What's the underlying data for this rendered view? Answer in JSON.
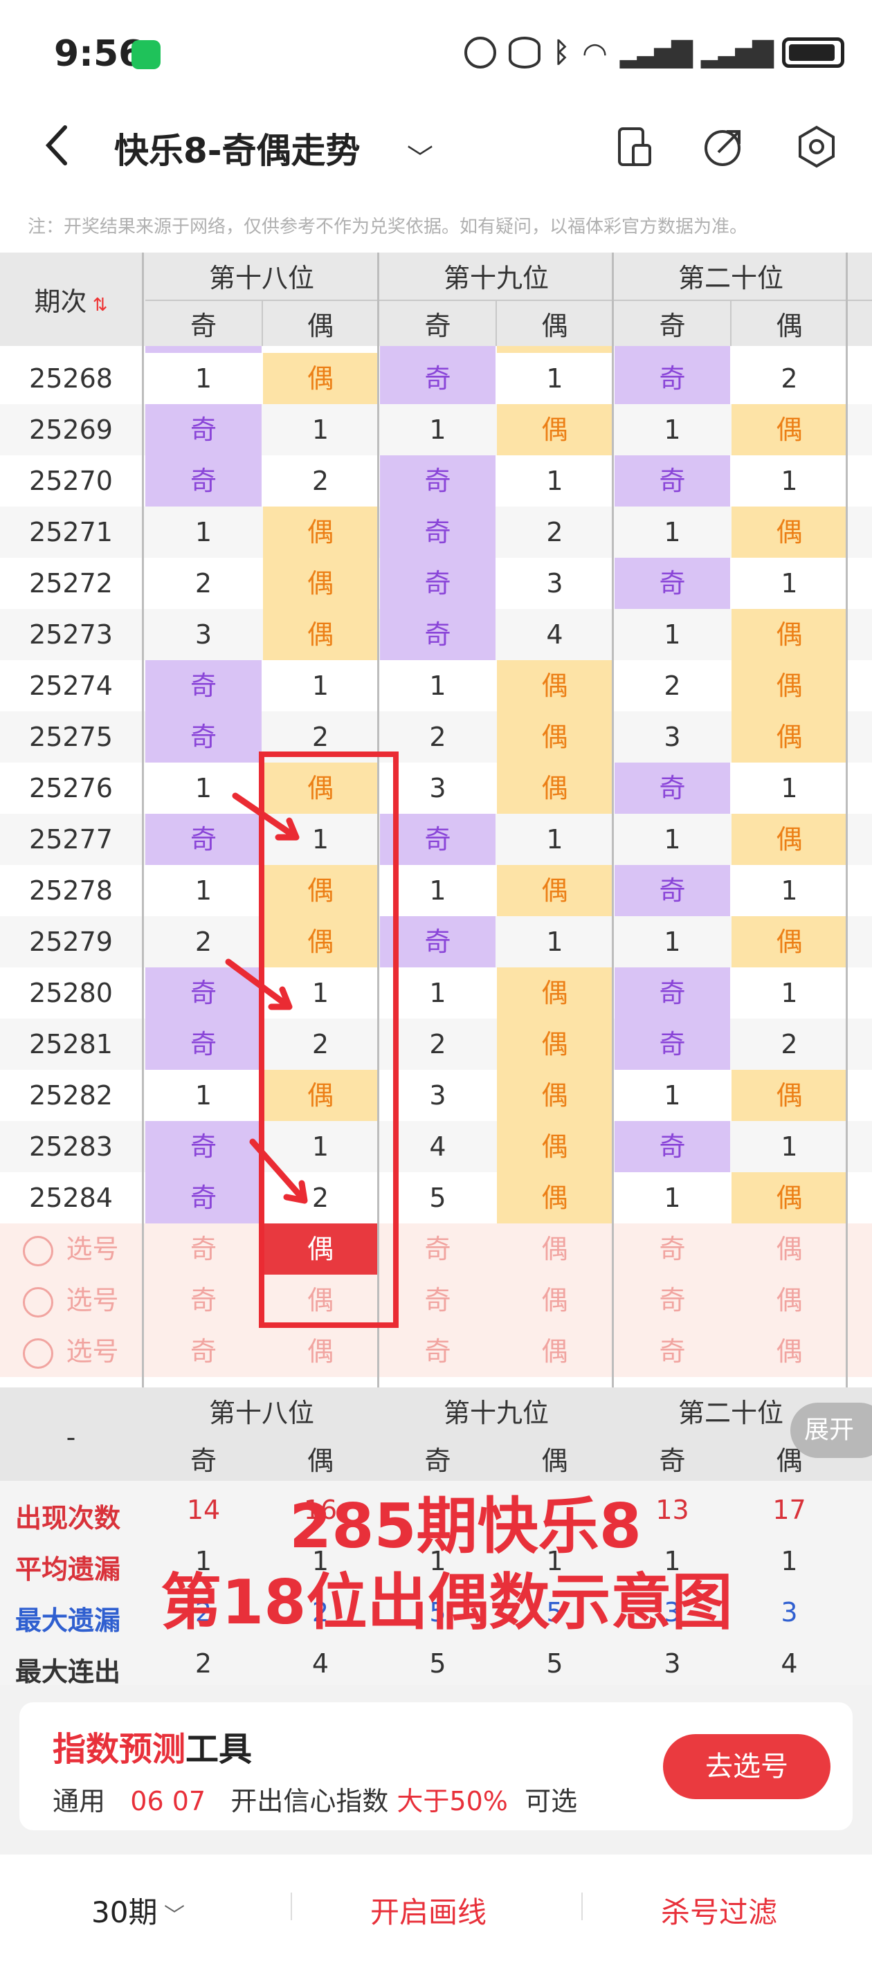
{
  "status": {
    "time": "9:56"
  },
  "header": {
    "title": "快乐8-奇偶走势"
  },
  "notice": "注：开奖结果来源于网络，仅供参考不作为兑奖依据。如有疑问，以福体彩官方数据为准。",
  "table": {
    "col_period": "期次",
    "groups": [
      "第十八位",
      "第十九位",
      "第二十位"
    ],
    "sub": [
      "奇",
      "偶",
      "奇",
      "偶",
      "奇",
      "偶"
    ],
    "rows": [
      {
        "p": "25268",
        "c": [
          "1",
          "偶",
          "奇",
          "1",
          "奇",
          "2"
        ],
        "t": [
          0,
          1,
          2,
          0,
          2,
          0
        ]
      },
      {
        "p": "25269",
        "c": [
          "奇",
          "1",
          "1",
          "偶",
          "1",
          "偶"
        ],
        "t": [
          2,
          0,
          0,
          1,
          0,
          1
        ]
      },
      {
        "p": "25270",
        "c": [
          "奇",
          "2",
          "奇",
          "1",
          "奇",
          "1"
        ],
        "t": [
          2,
          0,
          2,
          0,
          2,
          0
        ]
      },
      {
        "p": "25271",
        "c": [
          "1",
          "偶",
          "奇",
          "2",
          "1",
          "偶"
        ],
        "t": [
          0,
          1,
          2,
          0,
          0,
          1
        ]
      },
      {
        "p": "25272",
        "c": [
          "2",
          "偶",
          "奇",
          "3",
          "奇",
          "1"
        ],
        "t": [
          0,
          1,
          2,
          0,
          2,
          0
        ]
      },
      {
        "p": "25273",
        "c": [
          "3",
          "偶",
          "奇",
          "4",
          "1",
          "偶"
        ],
        "t": [
          0,
          1,
          2,
          0,
          0,
          1
        ]
      },
      {
        "p": "25274",
        "c": [
          "奇",
          "1",
          "1",
          "偶",
          "2",
          "偶"
        ],
        "t": [
          2,
          0,
          0,
          1,
          0,
          1
        ]
      },
      {
        "p": "25275",
        "c": [
          "奇",
          "2",
          "2",
          "偶",
          "3",
          "偶"
        ],
        "t": [
          2,
          0,
          0,
          1,
          0,
          1
        ]
      },
      {
        "p": "25276",
        "c": [
          "1",
          "偶",
          "3",
          "偶",
          "奇",
          "1"
        ],
        "t": [
          0,
          1,
          0,
          1,
          2,
          0
        ]
      },
      {
        "p": "25277",
        "c": [
          "奇",
          "1",
          "奇",
          "1",
          "1",
          "偶"
        ],
        "t": [
          2,
          0,
          2,
          0,
          0,
          1
        ]
      },
      {
        "p": "25278",
        "c": [
          "1",
          "偶",
          "1",
          "偶",
          "奇",
          "1"
        ],
        "t": [
          0,
          1,
          0,
          1,
          2,
          0
        ]
      },
      {
        "p": "25279",
        "c": [
          "2",
          "偶",
          "奇",
          "1",
          "1",
          "偶"
        ],
        "t": [
          0,
          1,
          2,
          0,
          0,
          1
        ]
      },
      {
        "p": "25280",
        "c": [
          "奇",
          "1",
          "1",
          "偶",
          "奇",
          "1"
        ],
        "t": [
          2,
          0,
          0,
          1,
          2,
          0
        ]
      },
      {
        "p": "25281",
        "c": [
          "奇",
          "2",
          "2",
          "偶",
          "奇",
          "2"
        ],
        "t": [
          2,
          0,
          0,
          1,
          2,
          0
        ]
      },
      {
        "p": "25282",
        "c": [
          "1",
          "偶",
          "3",
          "偶",
          "1",
          "偶"
        ],
        "t": [
          0,
          1,
          0,
          1,
          0,
          1
        ]
      },
      {
        "p": "25283",
        "c": [
          "奇",
          "1",
          "4",
          "偶",
          "奇",
          "1"
        ],
        "t": [
          2,
          0,
          0,
          1,
          2,
          0
        ]
      },
      {
        "p": "25284",
        "c": [
          "奇",
          "2",
          "5",
          "偶",
          "1",
          "偶"
        ],
        "t": [
          2,
          0,
          0,
          1,
          0,
          1
        ]
      }
    ],
    "pick_label": "选号",
    "pick_cells": [
      "奇",
      "偶",
      "奇",
      "偶",
      "奇",
      "偶"
    ],
    "selected_cell": "偶"
  },
  "stats": {
    "dash": "-",
    "expand": "展开",
    "rows": [
      {
        "label": "出现次数",
        "color": "#d9323a",
        "v": [
          "14",
          "16",
          "",
          "",
          "13",
          "17"
        ]
      },
      {
        "label": "平均遗漏",
        "color": "#d9323a",
        "v": [
          "1",
          "1",
          "1",
          "1",
          "1",
          "1"
        ]
      },
      {
        "label": "最大遗漏",
        "color": "#2f5fd0",
        "v": [
          "2",
          "2",
          "5",
          "5",
          "3",
          "3"
        ]
      },
      {
        "label": "最大连出",
        "color": "#333333",
        "v": [
          "2",
          "4",
          "5",
          "5",
          "3",
          "4"
        ]
      }
    ],
    "overlay1": "285期快乐8",
    "overlay2": "第18位出偶数示意图"
  },
  "card": {
    "title_red": "指数预测",
    "title_black": "工具",
    "l1": "通用",
    "nums": "06 07",
    "l2": "开出信心指数",
    "pct": "大于50%",
    "l3": "可选",
    "button": "去选号"
  },
  "bottom": {
    "periods": "30期",
    "draw": "开启画线",
    "filter": "杀号过滤"
  }
}
